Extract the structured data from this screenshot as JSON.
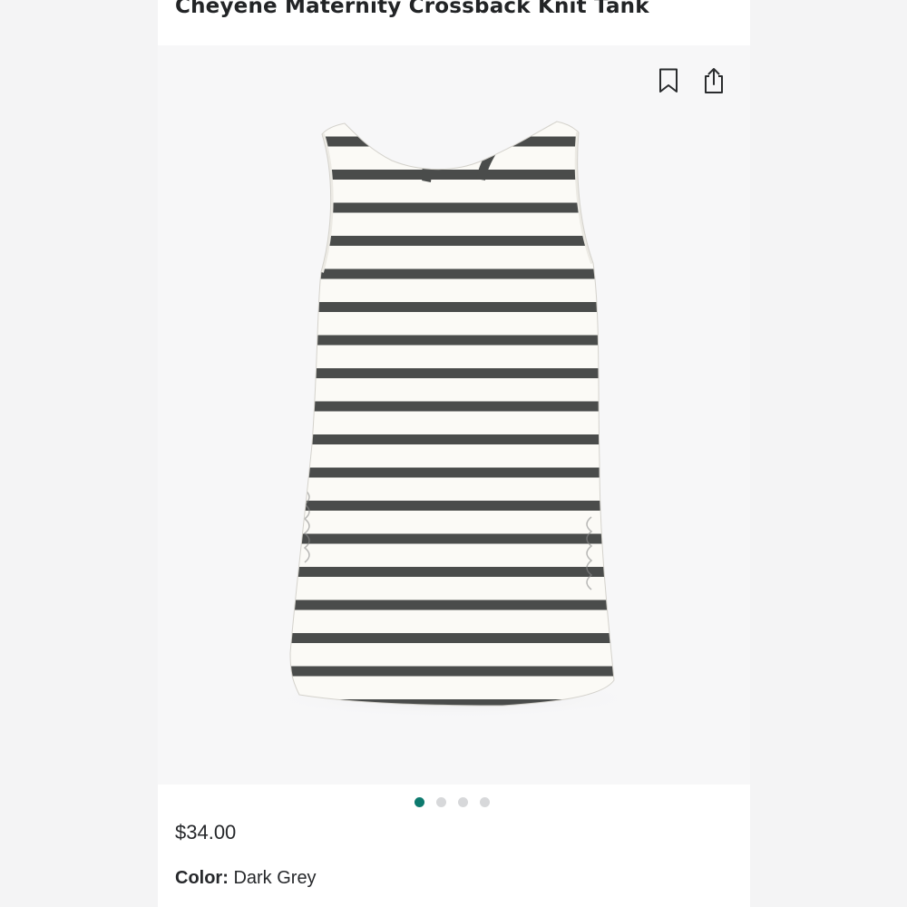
{
  "product": {
    "title": "Cheyene Maternity Crossback Knit Tank",
    "price": "$34.00",
    "color_label": "Color:",
    "color_value": "Dark Grey",
    "image": "striped-sleeveless-tank-photo"
  },
  "actions": {
    "bookmark_icon": "bookmark-icon",
    "share_icon": "share-icon"
  },
  "carousel": {
    "total": 4,
    "active_index": 0
  },
  "colors": {
    "accent": "#0d7a6e",
    "stripe": "#4a4c4b",
    "fabric": "#fbfaf6",
    "text": "#222426"
  }
}
